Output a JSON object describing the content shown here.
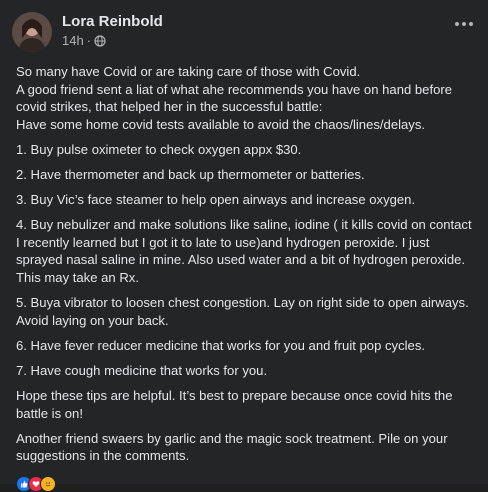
{
  "post": {
    "author": "Lora Reinbold",
    "time": "14h",
    "separator": "·",
    "privacy_icon": "globe-icon",
    "more_icon": "more-options-icon"
  },
  "body": {
    "intro": [
      "So many have Covid or are taking care of those with Covid.",
      "A good friend sent a liat of what ahe recommends you have on hand before covid strikes, that helped her in the successful battle:",
      "Have some home covid tests available to avoid the chaos/lines/delays."
    ],
    "items": [
      "1.  Buy pulse oximeter to check oxygen appx $30.",
      "2.  Have thermometer and back up thermometer or batteries.",
      "3.  Buy Vic’s face steamer to help open airways and increase oxygen.",
      "4.  Buy nebulizer and make solutions like saline, iodine ( it kills covid on contact I recently learned but  I got it to late to use)and hydrogen peroxide. I just sprayed nasal saline in mine.  Also used water and a bit of hydrogen peroxide. This may take an Rx.",
      "5.  Buya vibrator to loosen chest congestion.  Lay on right side to open airways.  Avoid laying on your back.",
      "6.  Have fever reducer medicine that works for you and fruit pop cycles.",
      "7.  Have cough medicine that works for you."
    ],
    "outro": [
      "Hope these tips are helpful.  It’s best to prepare  because once covid hits the battle is on!",
      "Another friend swaers by garlic and the magic sock treatment. Pile on your suggestions in the comments."
    ]
  },
  "colors": {
    "background": "#242526",
    "text": "#e4e6eb",
    "secondary_text": "#b0b3b8",
    "like": "#1877f2",
    "love": "#f0284a",
    "care": "#f7b125"
  }
}
